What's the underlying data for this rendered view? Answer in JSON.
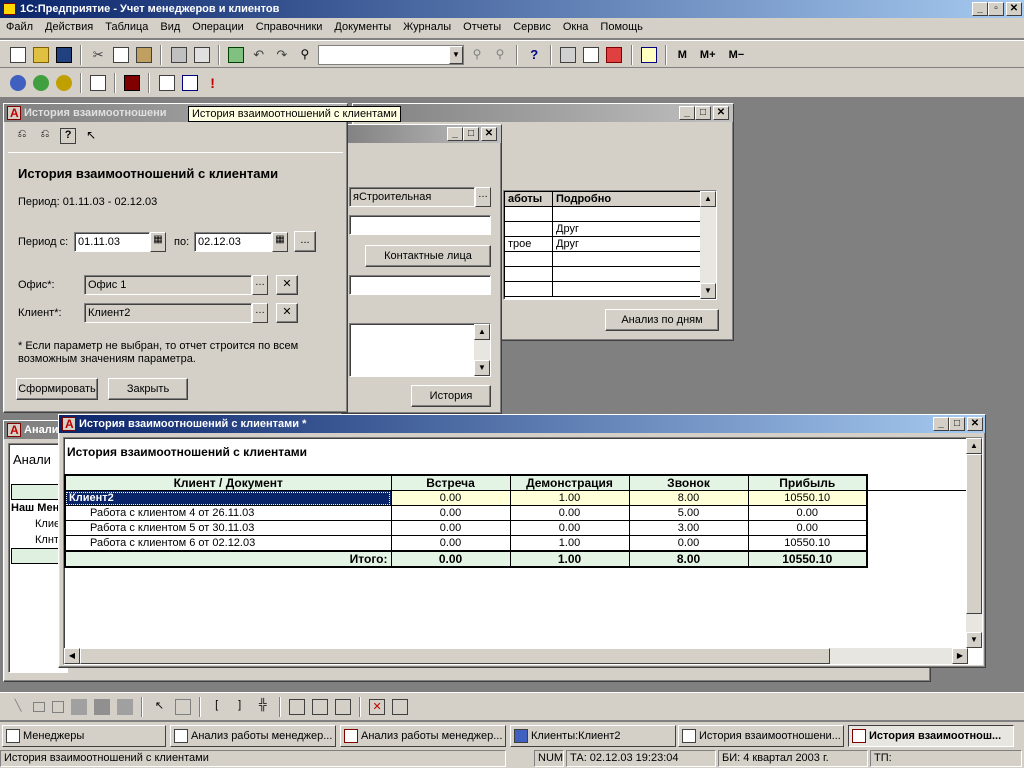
{
  "app": {
    "title": "1С:Предприятие - Учет менеджеров и клиентов",
    "menu": [
      "Файл",
      "Действия",
      "Таблица",
      "Вид",
      "Операции",
      "Справочники",
      "Документы",
      "Журналы",
      "Отчеты",
      "Сервис",
      "Окна",
      "Помощь"
    ],
    "toolbar_text_buttons": [
      "M",
      "M+",
      "M−"
    ]
  },
  "tooltip": "История взаимоотношений с клиентами",
  "form": {
    "title_short": "История взаимоотношени",
    "heading": "История взаимоотношений с клиентами",
    "period_text": "Период: 01.11.03 - 02.12.03",
    "period_from_label": "Период с:",
    "period_from": "01.11.03",
    "period_to_label": "по:",
    "period_to": "02.12.03",
    "office_label": "Офис*:",
    "office_value": "Офис 1",
    "client_label": "Клиент*:",
    "client_value": "Клиент2",
    "note": "* Если параметр не выбран, то отчет строится по всем возможным значениям параметра.",
    "generate_button": "Сформировать",
    "close_button": "Закрыть"
  },
  "client_window": {
    "field_value": "яСтроительная",
    "contacts_button": "Контактные лица",
    "history_button": "История"
  },
  "analysis_window": {
    "columns": [
      "аботы",
      "Подробно"
    ],
    "rows": [
      [
        "",
        ""
      ],
      [
        "",
        "Друг"
      ],
      [
        "трое",
        "Друг"
      ],
      [
        "",
        ""
      ],
      [
        "",
        ""
      ],
      [
        "",
        ""
      ]
    ],
    "daily_button": "Анализ по дням"
  },
  "bg_analysis": {
    "title": "Анали",
    "heading": "Анали",
    "header_cell": "Наш Мен",
    "rows": [
      "Клие",
      "Клнт"
    ]
  },
  "report": {
    "title": "История взаимоотношений с клиентами  *",
    "heading": "История взаимоотношений с клиентами",
    "columns": [
      "Клиент / Документ",
      "Встреча",
      "Демонстрация",
      "Звонок",
      "Прибыль"
    ],
    "rows": [
      {
        "name": "Клиент2",
        "values": [
          "0.00",
          "1.00",
          "8.00",
          "10550.10"
        ],
        "group": true
      },
      {
        "name": "Работа с клиентом 4 от 26.11.03",
        "values": [
          "0.00",
          "0.00",
          "5.00",
          "0.00"
        ]
      },
      {
        "name": "Работа с клиентом 5 от 30.11.03",
        "values": [
          "0.00",
          "0.00",
          "3.00",
          "0.00"
        ]
      },
      {
        "name": "Работа с клиентом 6 от 02.12.03",
        "values": [
          "0.00",
          "1.00",
          "0.00",
          "10550.10"
        ]
      }
    ],
    "total": {
      "name": "Итого:",
      "values": [
        "0.00",
        "1.00",
        "8.00",
        "10550.10"
      ]
    }
  },
  "taskbar": [
    "Менеджеры",
    "Анализ работы менеджер...",
    "Анализ работы менеджер...",
    "Клиенты:Клиент2",
    "История взаимоотношени...",
    "История взаимоотнош..."
  ],
  "status": {
    "message": "История взаимоотношений с клиентами",
    "num": "NUM",
    "ta": "ТА: 02.12.03  19:23:04",
    "bi": "БИ: 4 квартал 2003 г.",
    "tp": "ТП:"
  }
}
